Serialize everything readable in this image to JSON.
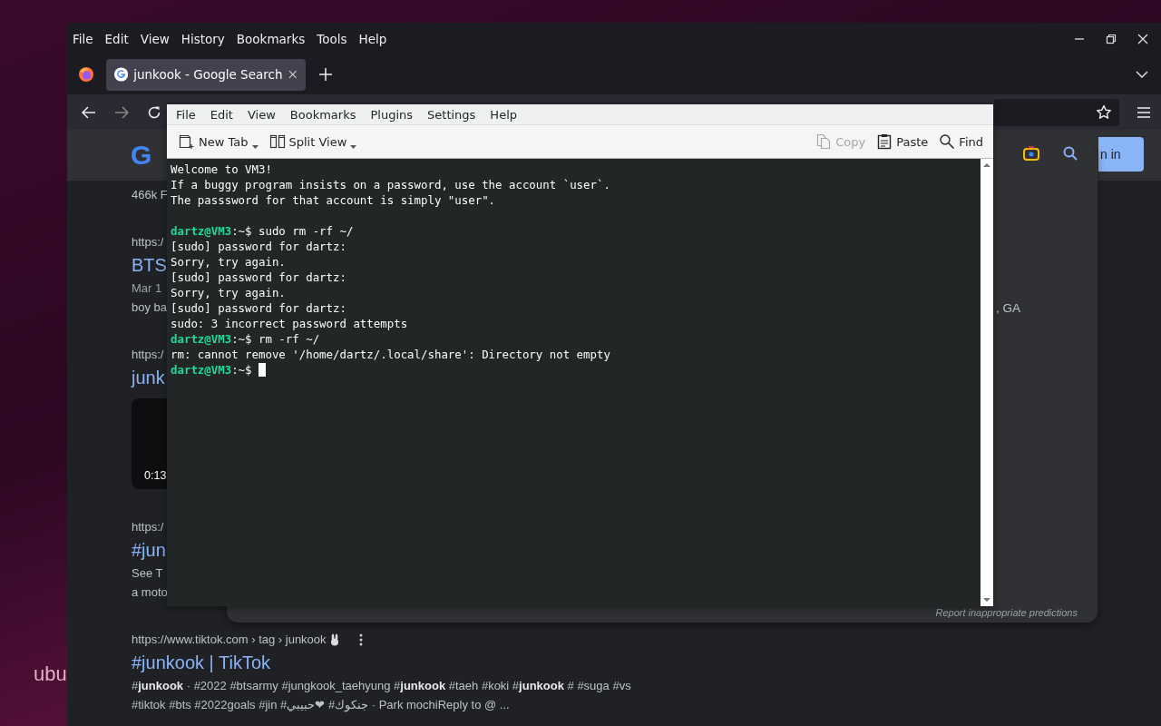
{
  "desktop": {
    "wallpaper_text": "ubu"
  },
  "browser": {
    "menu": [
      "File",
      "Edit",
      "View",
      "History",
      "Bookmarks",
      "Tools",
      "Help"
    ],
    "tabs": [
      {
        "title": "junkook - Google Search",
        "selected": true
      }
    ],
    "google": {
      "logo": "G",
      "sign_in": "n in",
      "results": [
        {
          "lines": [
            {
              "kind": "meta",
              "text": "466k F"
            }
          ]
        },
        {
          "lines": [
            {
              "kind": "url",
              "text": "https:/"
            },
            {
              "kind": "title",
              "text": "BTS"
            },
            {
              "kind": "date",
              "text": "Mar 1"
            },
            {
              "kind": "snippet",
              "text": "boy ba"
            }
          ]
        },
        {
          "lines": [
            {
              "kind": "url",
              "text": "https:/"
            },
            {
              "kind": "title",
              "text": "junk"
            },
            {
              "kind": "video",
              "text": "0:13"
            }
          ]
        },
        {
          "lines": [
            {
              "kind": "url",
              "text": "https:/"
            },
            {
              "kind": "title",
              "text": "#jun"
            },
            {
              "kind": "snippet",
              "text": "See T"
            },
            {
              "kind": "snippet",
              "text": "a moto"
            }
          ]
        }
      ],
      "tiktok": {
        "url": "https://www.tiktok.com › tag › junkook",
        "title": "#junkook | TikTok",
        "snippet": [
          "#**junkook** · #2022 #btsarmy #jungkook_taehyung #**junkook** #taeh #koki #**junkook** # #suga #vs",
          "#tiktok #bts #2022goals #jin #جنكوك# ❤حبيبي · Park mochiReply to @ ..."
        ]
      },
      "suggestions": {
        "fragment": ", GA",
        "report": "Report inappropriate predictions"
      }
    }
  },
  "terminal": {
    "menu": [
      "File",
      "Edit",
      "View",
      "Bookmarks",
      "Plugins",
      "Settings",
      "Help"
    ],
    "toolbar_left": [
      {
        "label": "New Tab",
        "kind": "new-tab"
      },
      {
        "label": "Split View",
        "kind": "split"
      }
    ],
    "toolbar_right": [
      {
        "label": "Copy",
        "kind": "copy",
        "disabled": true
      },
      {
        "label": "Paste",
        "kind": "paste",
        "disabled": false
      },
      {
        "label": "Find",
        "kind": "find",
        "disabled": false
      }
    ],
    "lines": [
      {
        "kind": "text",
        "text": "Welcome to VM3!"
      },
      {
        "kind": "text",
        "text": "If a buggy program insists on a password, use the account `user`."
      },
      {
        "kind": "text",
        "text": "The passsword for that account is simply \"user\"."
      },
      {
        "kind": "blank"
      },
      {
        "kind": "prompt",
        "user_host": "dartz@VM3",
        "path": ":~$",
        "command": "sudo rm -rf ~/",
        "cursor": false
      },
      {
        "kind": "text",
        "text": "[sudo] password for dartz:"
      },
      {
        "kind": "text",
        "text": "Sorry, try again."
      },
      {
        "kind": "text",
        "text": "[sudo] password for dartz:"
      },
      {
        "kind": "text",
        "text": "Sorry, try again."
      },
      {
        "kind": "text",
        "text": "[sudo] password for dartz:"
      },
      {
        "kind": "text",
        "text": "sudo: 3 incorrect password attempts"
      },
      {
        "kind": "prompt",
        "user_host": "dartz@VM3",
        "path": ":~$",
        "command": "rm -rf ~/",
        "cursor": false
      },
      {
        "kind": "text",
        "text": "rm: cannot remove '/home/dartz/.local/share': Directory not empty"
      },
      {
        "kind": "prompt",
        "user_host": "dartz@VM3",
        "path": ":~$",
        "cursor": true
      }
    ]
  }
}
